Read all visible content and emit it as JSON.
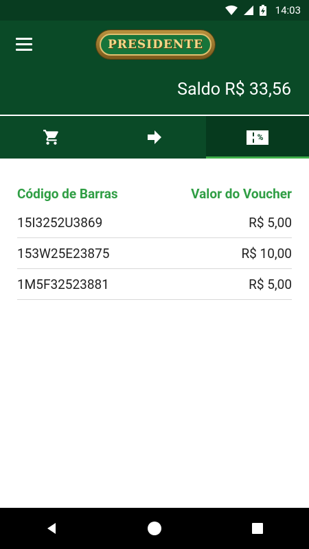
{
  "status_bar": {
    "time": "14:03"
  },
  "app_bar": {
    "logo_text": "PRESIDENTE",
    "balance": "Saldo R$ 33,56"
  },
  "tabs": [
    {
      "icon": "cart-icon",
      "active": false
    },
    {
      "icon": "arrow-right-icon",
      "active": false
    },
    {
      "icon": "voucher-percent-icon",
      "label": "%",
      "active": true
    }
  ],
  "vouchers": {
    "headers": {
      "code": "Código de Barras",
      "value": "Valor do Voucher"
    },
    "rows": [
      {
        "code": "15I3252U3869",
        "value": "R$ 5,00"
      },
      {
        "code": "153W25E23875",
        "value": "R$ 10,00"
      },
      {
        "code": "1M5F32523881",
        "value": "R$ 5,00"
      }
    ]
  },
  "nav_bar": {
    "icons": [
      "back-icon",
      "home-icon",
      "recents-icon"
    ]
  }
}
